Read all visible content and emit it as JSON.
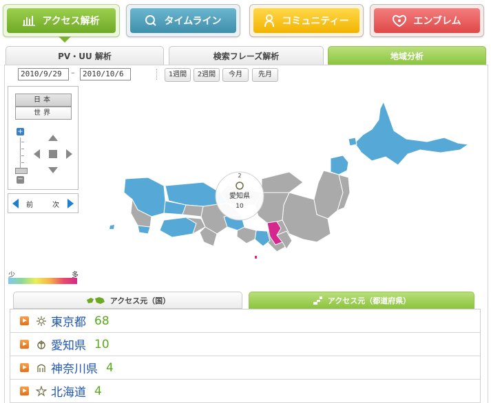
{
  "nav": {
    "tabs": [
      {
        "label": "アクセス解析",
        "icon": "bar-chart-icon"
      },
      {
        "label": "タイムライン",
        "icon": "search-icon"
      },
      {
        "label": "コミュニティー",
        "icon": "person-icon"
      },
      {
        "label": "エンブレム",
        "icon": "emblem-icon"
      }
    ],
    "active": "アクセス解析"
  },
  "subtabs": {
    "items": [
      "PV・UU 解析",
      "検索フレーズ解析",
      "地域分析"
    ],
    "active": "地域分析"
  },
  "date_range": {
    "start": "2010/9/29",
    "separator": "–",
    "end": "2010/10/6"
  },
  "range_buttons": [
    "1週間",
    "2週間",
    "今月",
    "先月"
  ],
  "map_control": {
    "japan_label": "日本",
    "world_label": "世界",
    "prev_label": "前",
    "next_label": "次"
  },
  "tooltip": {
    "rank": "2",
    "name": "愛知県",
    "count": "10"
  },
  "legend": {
    "low": "少",
    "high": "多"
  },
  "bottom_tabs": {
    "country": "アクセス元（国）",
    "prefecture": "アクセス元（都道府県）",
    "active": "prefecture"
  },
  "list": [
    {
      "name": "東京都",
      "count": "68",
      "emblem": "tokyo-emblem-icon"
    },
    {
      "name": "愛知県",
      "count": "10",
      "emblem": "aichi-emblem-icon"
    },
    {
      "name": "神奈川県",
      "count": "4",
      "emblem": "kanagawa-emblem-icon"
    },
    {
      "name": "北海道",
      "count": "4",
      "emblem": "hokkaido-emblem-icon"
    }
  ],
  "colors": {
    "accent_green": "#8cc43f",
    "map_blue": "#56a9d6",
    "map_gray": "#aaaaaa",
    "map_pink": "#d6278d",
    "link_blue": "#1f56b0",
    "count_green": "#5aa81d"
  }
}
